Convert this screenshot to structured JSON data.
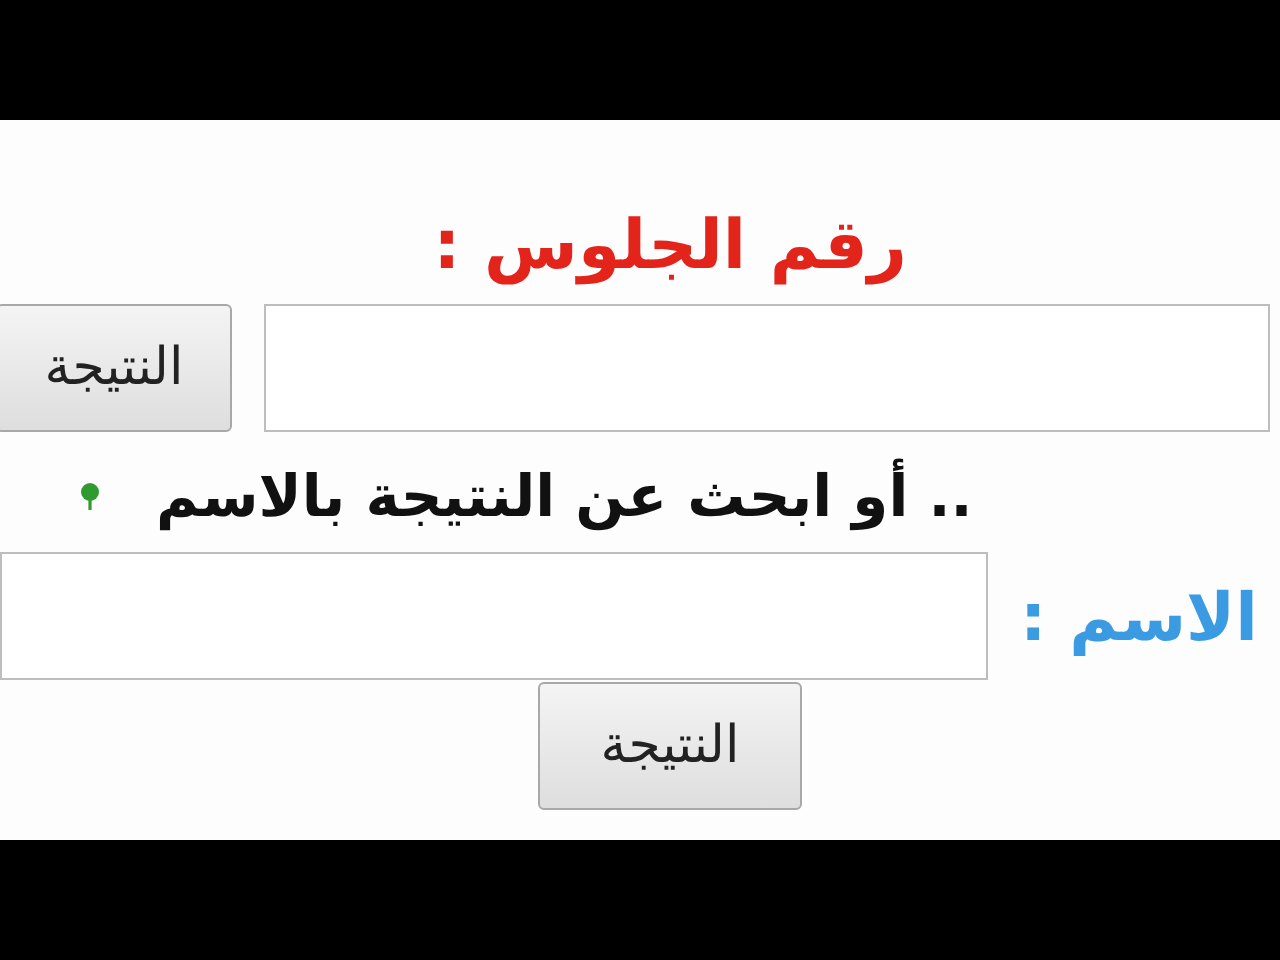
{
  "title": "رقم الجلوس :",
  "seat_number_row": {
    "button": "النتيجة"
  },
  "hint": ".. أو ابحث عن النتيجة بالاسم",
  "name_row": {
    "label": "الاسم :",
    "button": "النتيجة"
  }
}
